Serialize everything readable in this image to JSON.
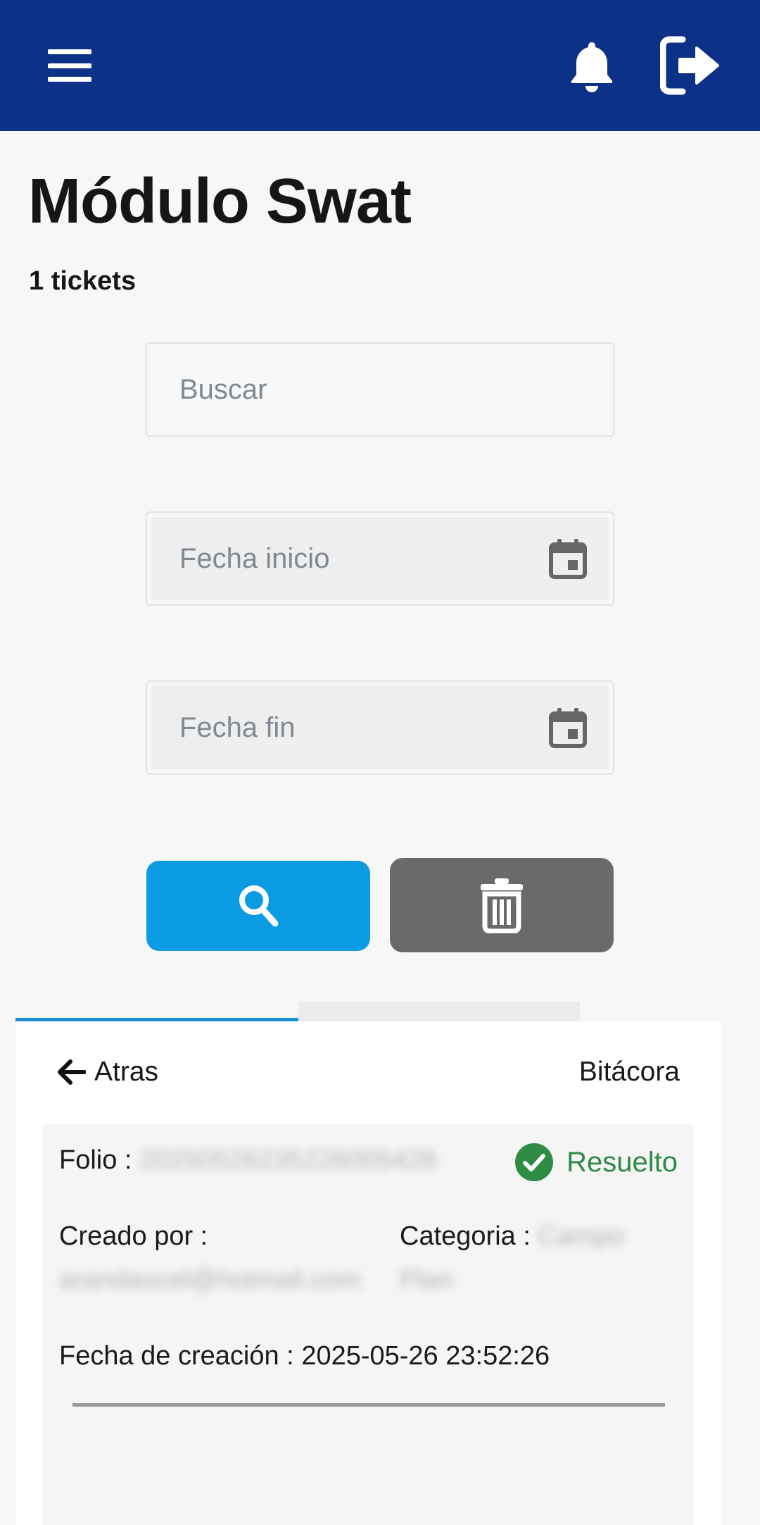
{
  "header": {
    "menu_icon": "hamburger-menu-icon",
    "bell_icon": "bell-icon",
    "logout_icon": "logout-icon",
    "background_color": "#0d3186"
  },
  "page": {
    "title": "Módulo Swat",
    "ticket_count": "1 tickets"
  },
  "filters": {
    "search_placeholder": "Buscar",
    "start_date_placeholder": "Fecha inicio",
    "end_date_placeholder": "Fecha fin",
    "calendar_icon": "calendar-icon",
    "search_button_icon": "search-icon",
    "search_button_color": "#0b9be3",
    "clear_button_icon": "trash-icon",
    "clear_button_color": "#6a6a6a"
  },
  "ticket_view": {
    "back_label": "Atras",
    "log_label": "Bitácora",
    "folio_label": "Folio :",
    "folio_value": "20250526235226005428",
    "status_label": "Resuelto",
    "status_color": "#2e8b44",
    "created_by_label": "Creado por :",
    "created_by_value": "arandaxcel@hotmail.com",
    "category_label": "Categoria :",
    "category_value_line1": "Campo",
    "category_value_line2": "Plan",
    "created_date_label": "Fecha de creación :",
    "created_date_value": "2025-05-26 23:52:26"
  }
}
